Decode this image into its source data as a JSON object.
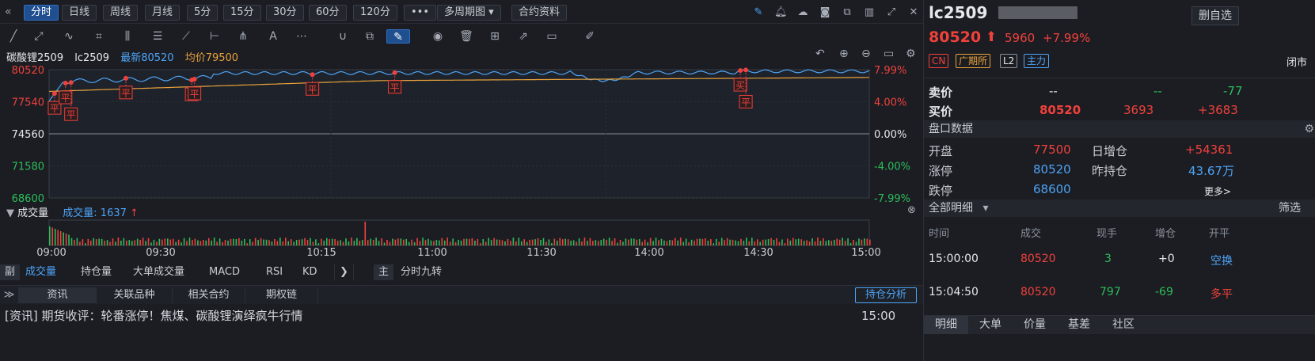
{
  "toolbar": {
    "periods": [
      {
        "label": "分时",
        "active": true
      },
      {
        "label": "日线",
        "active": false
      },
      {
        "label": "周线",
        "active": false
      },
      {
        "label": "月线",
        "active": false
      },
      {
        "label": "5分",
        "active": false
      },
      {
        "label": "15分",
        "active": false
      },
      {
        "label": "30分",
        "active": false
      },
      {
        "label": "60分",
        "active": false
      },
      {
        "label": "120分",
        "active": false
      }
    ],
    "more_label": "•••",
    "multi_period_label": "多周期图 ▾",
    "contract_info_label": "合约资料"
  },
  "info_line": {
    "name": "碳酸锂2509",
    "code": "lc2509",
    "latest_label": "最新80520",
    "avg_label": "均价79500"
  },
  "price_axis": [
    "80520",
    "77540",
    "74560",
    "71580",
    "68600"
  ],
  "pct_axis": [
    "7.99%",
    "4.00%",
    "0.00%",
    "-4.00%",
    "-7.99%"
  ],
  "trade_markers": [
    {
      "label": "平",
      "time_index": 2
    },
    {
      "label": "平",
      "time_index": 6
    },
    {
      "label": "平",
      "time_index": 8
    },
    {
      "label": "平",
      "time_index": 28
    },
    {
      "label": "平",
      "time_index": 52
    },
    {
      "label": "平",
      "time_index": 53
    },
    {
      "label": "平",
      "time_index": 96
    },
    {
      "label": "平",
      "time_index": 126
    },
    {
      "label": "买",
      "time_index": 252
    },
    {
      "label": "平",
      "time_index": 254
    }
  ],
  "volume_header": {
    "dropdown_label": "成交量",
    "value_label": "成交量: 1637"
  },
  "time_axis": [
    "09:00",
    "09:30",
    "10:15",
    "11:00",
    "11:30",
    "14:00",
    "14:30",
    "15:00"
  ],
  "sub_indicator": {
    "prefix": "副",
    "items": [
      "成交量",
      "持仓量",
      "大单成交量",
      "MACD",
      "RSI",
      "KD"
    ],
    "main_prefix": "主",
    "main_item": "分时九转"
  },
  "news_tabs": [
    "资讯",
    "关联品种",
    "相关合约",
    "期权链"
  ],
  "position_analysis_label": "持仓分析",
  "news": [
    {
      "text": "[资讯]   期货收评：轮番涨停！焦煤、碳酸锂演绎疯牛行情",
      "time": "15:00"
    }
  ],
  "quote": {
    "code": "lc2509",
    "delete_label": "删自选",
    "price": "80520",
    "change": "5960",
    "change_pct": "+7.99%",
    "tags": [
      "CN",
      "广期所",
      "L2",
      "主力"
    ],
    "market_status": "闭市",
    "ask_label": "卖价",
    "ask_price": "--",
    "ask_vol": "--",
    "ask_chg": "-77",
    "bid_label": "买价",
    "bid_price": "80520",
    "bid_vol": "3693",
    "bid_chg": "+3683"
  },
  "disk_header": "盘口数据",
  "disk_rows": [
    {
      "l1": "开盘",
      "v1": "77500",
      "l2": "日增仓",
      "v2": "+54361"
    },
    {
      "l1": "涨停",
      "v1": "80520",
      "l2": "昨持仓",
      "v2": "43.67万"
    },
    {
      "l1": "跌停",
      "v1": "68600",
      "l2": "",
      "v2": "更多>"
    }
  ],
  "detail_header": "全部明细",
  "detail_filter": "筛选",
  "detail_columns": [
    "时间",
    "成交",
    "现手",
    "增仓",
    "开平"
  ],
  "detail_rows": [
    {
      "time": "15:00:00",
      "price": "80520",
      "hand": "3",
      "inc": "+0",
      "type": "空换"
    },
    {
      "time": "15:04:50",
      "price": "80520",
      "hand": "797",
      "inc": "-69",
      "type": "多平"
    }
  ],
  "bottom_tabs": [
    "明细",
    "大单",
    "价量",
    "基差",
    "社区"
  ],
  "colors": {
    "up": "#f0413b",
    "down": "#2dbd5a",
    "price_line": "#4ea4f5",
    "avg_line": "#e9a23b",
    "accent": "#1f4f8f"
  }
}
